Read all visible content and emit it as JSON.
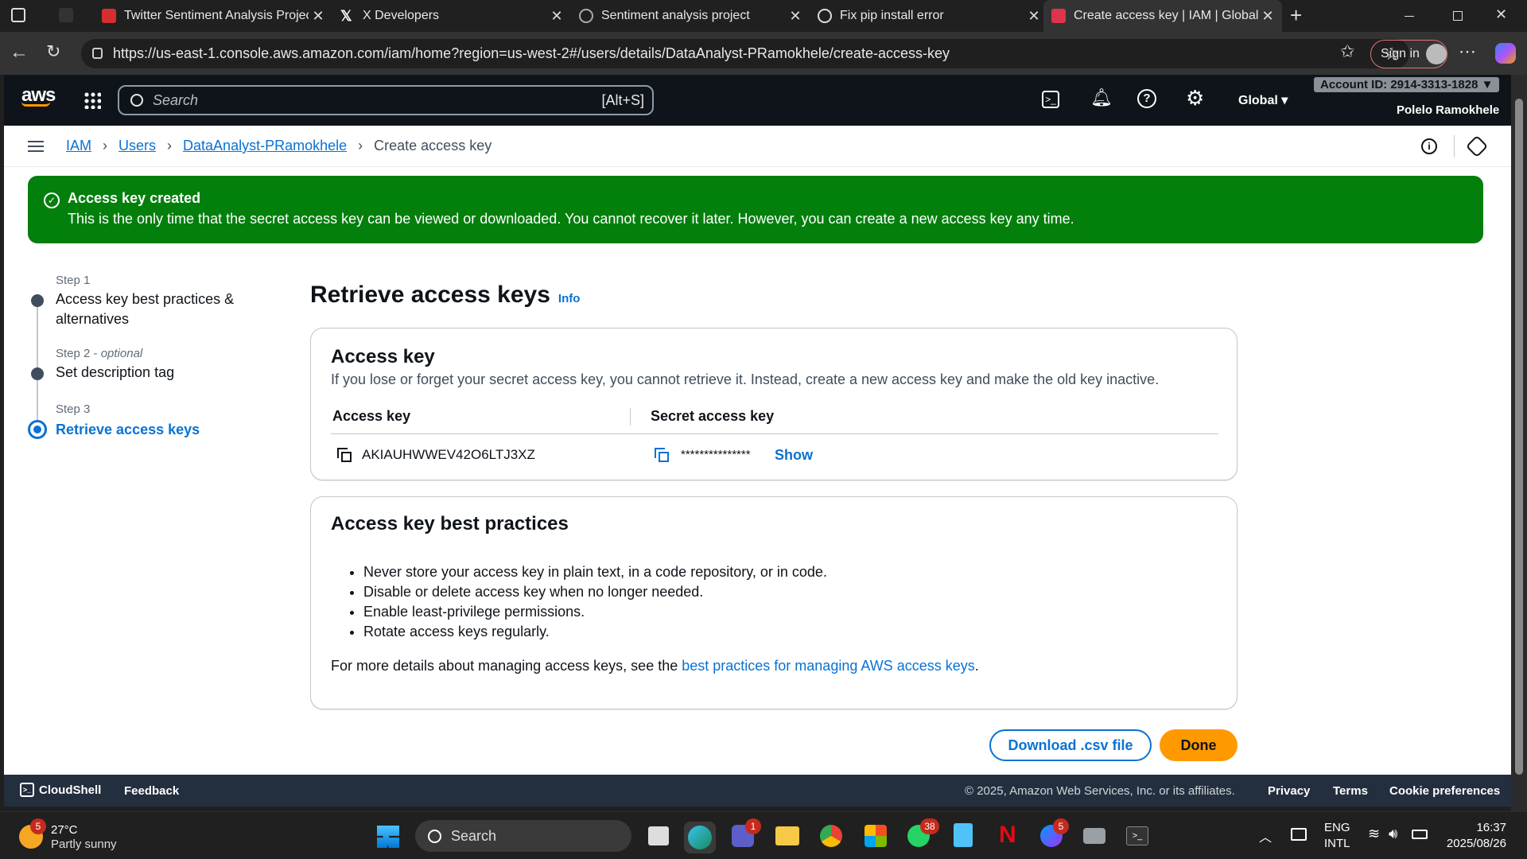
{
  "browser": {
    "tabs": [
      {
        "label": "Twitter Sentiment Analysis Project"
      },
      {
        "label": "X Developers"
      },
      {
        "label": "Sentiment analysis project"
      },
      {
        "label": "Fix pip install error"
      },
      {
        "label": "Create access key | IAM | Global"
      }
    ],
    "url": "https://us-east-1.console.aws.amazon.com/iam/home?region=us-west-2#/users/details/DataAnalyst-PRamokhele/create-access-key",
    "sign_in": "Sign in"
  },
  "aws": {
    "logo": "aws",
    "search_placeholder": "Search",
    "search_shortcut": "[Alt+S]",
    "region": "Global",
    "account": "Account ID: 2914-3313-1828 ▼",
    "user": "Polelo Ramokhele"
  },
  "breadcrumb": {
    "items": [
      "IAM",
      "Users",
      "DataAnalyst-PRamokhele"
    ],
    "current": "Create access key"
  },
  "flash": {
    "title": "Access key created",
    "message": "This is the only time that the secret access key can be viewed or downloaded. You cannot recover it later. However, you can create a new access key any time."
  },
  "steps": [
    {
      "step": "Step 1",
      "optional": "",
      "label1": "Access key best practices &",
      "label2": "alternatives"
    },
    {
      "step": "Step 2 - ",
      "optional": "optional",
      "label1": "Set description tag",
      "label2": ""
    },
    {
      "step": "Step 3",
      "optional": "",
      "label1": "Retrieve access keys",
      "label2": ""
    }
  ],
  "page": {
    "title": "Retrieve access keys",
    "info": "Info"
  },
  "access_key_card": {
    "title": "Access key",
    "description": "If you lose or forget your secret access key, you cannot retrieve it. Instead, create a new access key and make the old key inactive.",
    "col_access_key": "Access key",
    "col_secret": "Secret access key",
    "access_key_value": "AKIAUHWWEV42O6LTJ3XZ",
    "secret_masked": "***************",
    "show": "Show"
  },
  "best_practices": {
    "title": "Access key best practices",
    "items": [
      "Never store your access key in plain text, in a code repository, or in code.",
      "Disable or delete access key when no longer needed.",
      "Enable least-privilege permissions.",
      "Rotate access keys regularly."
    ],
    "more_prefix": "For more details about managing access keys, see the ",
    "more_link": "best practices for managing AWS access keys",
    "more_suffix": "."
  },
  "buttons": {
    "download": "Download .csv file",
    "done": "Done"
  },
  "footer": {
    "cloudshell": "CloudShell",
    "feedback": "Feedback",
    "copyright": "© 2025, Amazon Web Services, Inc. or its affiliates.",
    "privacy": "Privacy",
    "terms": "Terms",
    "cookie": "Cookie preferences"
  },
  "taskbar": {
    "temp": "27°C",
    "weather": "Partly sunny",
    "weather_badge": "5",
    "search": "Search",
    "teams_badge": "1",
    "whatsapp_badge": "38",
    "messenger_badge": "5",
    "lang1": "ENG",
    "lang2": "INTL",
    "time": "16:37",
    "date": "2025/08/26"
  },
  "colors": {
    "aws_orange": "#ff9900",
    "success_green": "#037f0c",
    "link_blue": "#0972d3",
    "aws_dark": "#0f141a"
  }
}
